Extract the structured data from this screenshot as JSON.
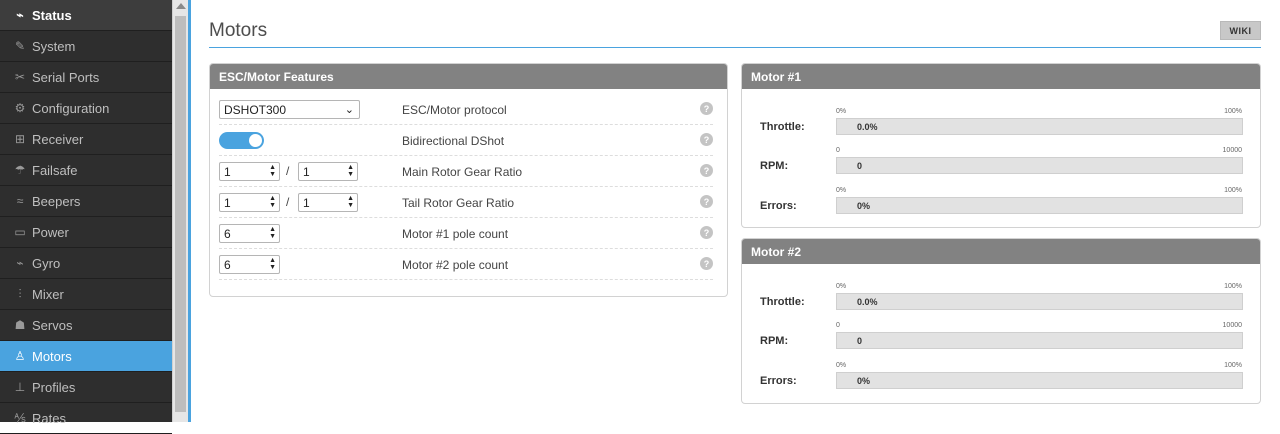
{
  "sidebar": {
    "items": [
      {
        "label": "Status",
        "icon": "pulse-icon"
      },
      {
        "label": "System",
        "icon": "wrench-icon"
      },
      {
        "label": "Serial Ports",
        "icon": "plug-icon"
      },
      {
        "label": "Configuration",
        "icon": "gear-icon"
      },
      {
        "label": "Receiver",
        "icon": "receiver-icon"
      },
      {
        "label": "Failsafe",
        "icon": "parachute-icon"
      },
      {
        "label": "Beepers",
        "icon": "beeper-icon"
      },
      {
        "label": "Power",
        "icon": "battery-icon"
      },
      {
        "label": "Gyro",
        "icon": "gyro-icon"
      },
      {
        "label": "Mixer",
        "icon": "sliders-icon"
      },
      {
        "label": "Servos",
        "icon": "servo-icon"
      },
      {
        "label": "Motors",
        "icon": "motor-icon"
      },
      {
        "label": "Profiles",
        "icon": "sitemap-icon"
      },
      {
        "label": "Rates",
        "icon": "rates-icon"
      }
    ],
    "active": "Motors"
  },
  "page": {
    "title": "Motors",
    "wiki_label": "WIKI"
  },
  "features": {
    "header": "ESC/Motor Features",
    "protocol": {
      "value": "DSHOT300",
      "label": "ESC/Motor protocol"
    },
    "bidir": {
      "on": true,
      "label": "Bidirectional DShot"
    },
    "main_gear": {
      "a": "1",
      "b": "1",
      "label": "Main Rotor Gear Ratio"
    },
    "tail_gear": {
      "a": "1",
      "b": "1",
      "label": "Tail Rotor Gear Ratio"
    },
    "motor1_poles": {
      "value": "6",
      "label": "Motor #1 pole count"
    },
    "motor2_poles": {
      "value": "6",
      "label": "Motor #2 pole count"
    },
    "slash": "/",
    "help": "?"
  },
  "motors": [
    {
      "header": "Motor #1",
      "throttle": {
        "label": "Throttle:",
        "min": "0%",
        "max": "100%",
        "value": "0.0%",
        "fraction": 0
      },
      "rpm": {
        "label": "RPM:",
        "min": "0",
        "max": "10000",
        "value": "0",
        "fraction": 0
      },
      "errors": {
        "label": "Errors:",
        "min": "0%",
        "max": "100%",
        "value": "0%",
        "fraction": 0
      }
    },
    {
      "header": "Motor #2",
      "throttle": {
        "label": "Throttle:",
        "min": "0%",
        "max": "100%",
        "value": "0.0%",
        "fraction": 0
      },
      "rpm": {
        "label": "RPM:",
        "min": "0",
        "max": "10000",
        "value": "0",
        "fraction": 0
      },
      "errors": {
        "label": "Errors:",
        "min": "0%",
        "max": "100%",
        "value": "0%",
        "fraction": 0
      }
    }
  ],
  "colors": {
    "accent": "#4aa3df",
    "sidebar_bg": "#2e2e2e",
    "panel_header": "#828282"
  }
}
